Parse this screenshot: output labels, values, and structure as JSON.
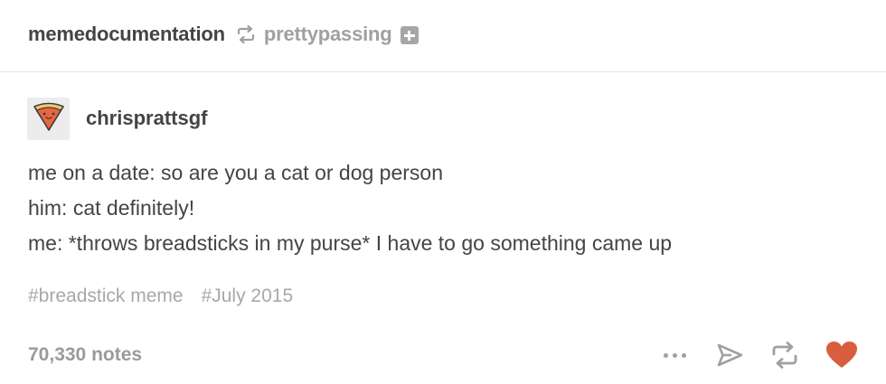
{
  "header": {
    "author": "memedocumentation",
    "reblogged_from": "prettypassing"
  },
  "trail": {
    "username": "chrisprattsgf",
    "avatar_icon": "pizza-slice-icon",
    "lines": [
      "me on a date: so are you a cat or dog person",
      "him: cat definitely!",
      "me: *throws breadsticks in my purse* I have to go something came up"
    ]
  },
  "tags": [
    "#breadstick meme",
    "#July 2015"
  ],
  "footer": {
    "notes": "70,330 notes",
    "actions": [
      "more-icon",
      "share-icon",
      "reblog-icon",
      "heart-icon"
    ]
  },
  "colors": {
    "text": "#444444",
    "muted": "#a0a0a0",
    "like": "#d95e40",
    "avatar_orange": "#e8663d"
  }
}
